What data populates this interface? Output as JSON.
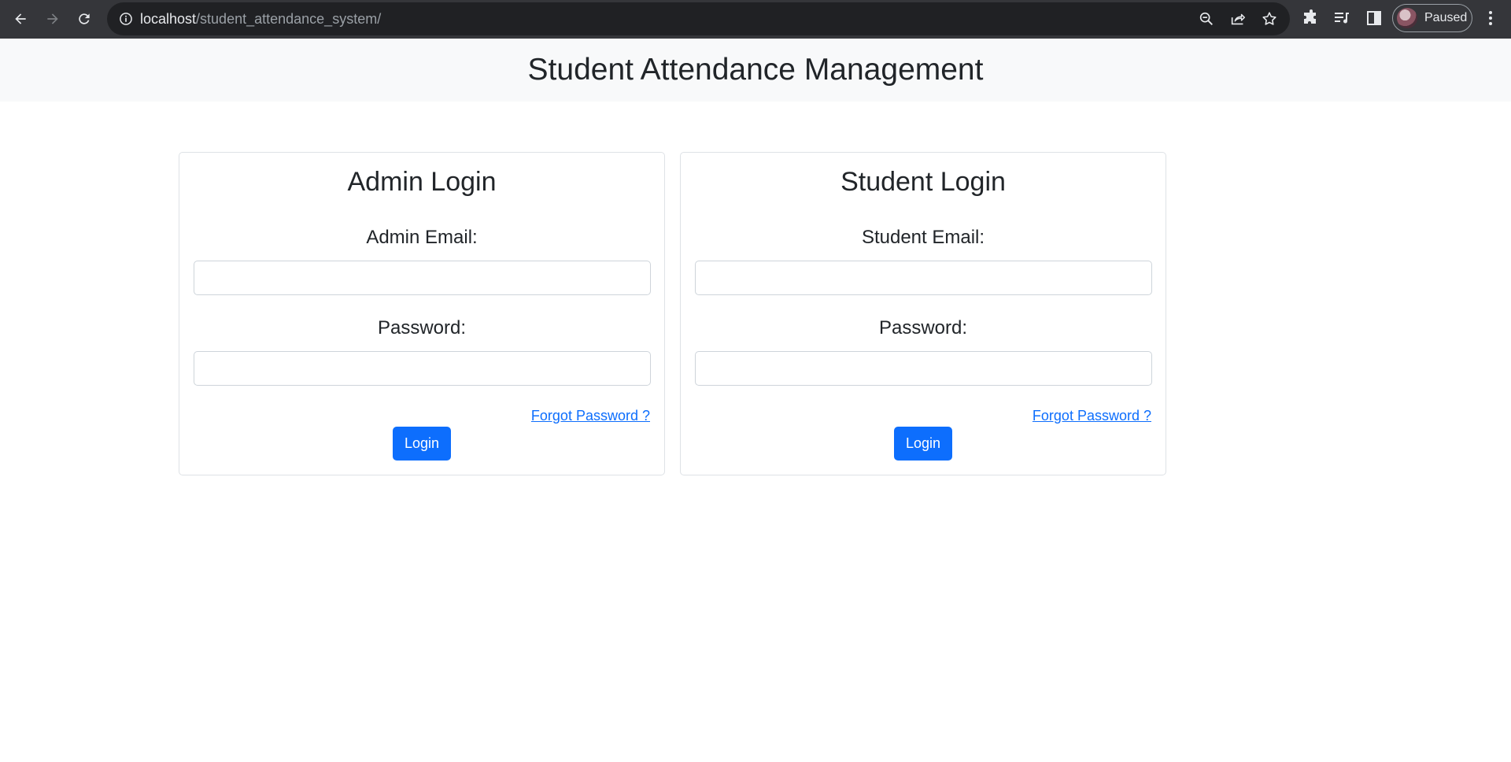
{
  "browser": {
    "url_host": "localhost",
    "url_path": "/student_attendance_system/",
    "profile_label": "Paused",
    "icons": [
      "back-icon",
      "forward-icon",
      "reload-icon",
      "info-icon",
      "zoom-out-icon",
      "share-icon",
      "star-icon",
      "extensions-icon",
      "media-icon",
      "side-panel-icon",
      "avatar",
      "more-menu-icon"
    ]
  },
  "header": {
    "title": "Student Attendance Management"
  },
  "admin": {
    "title": "Admin Login",
    "email_label": "Admin Email:",
    "email_value": "",
    "password_label": "Password:",
    "password_value": "",
    "forgot_label": "Forgot Password ?",
    "login_label": "Login"
  },
  "student": {
    "title": "Student Login",
    "email_label": "Student Email:",
    "email_value": "",
    "password_label": "Password:",
    "password_value": "",
    "forgot_label": "Forgot Password ?",
    "login_label": "Login"
  },
  "colors": {
    "chrome_bg": "#35363a",
    "header_bg": "#f8f9fa",
    "primary": "#0d6efd",
    "text": "#212529",
    "border": "#dee2e6"
  }
}
